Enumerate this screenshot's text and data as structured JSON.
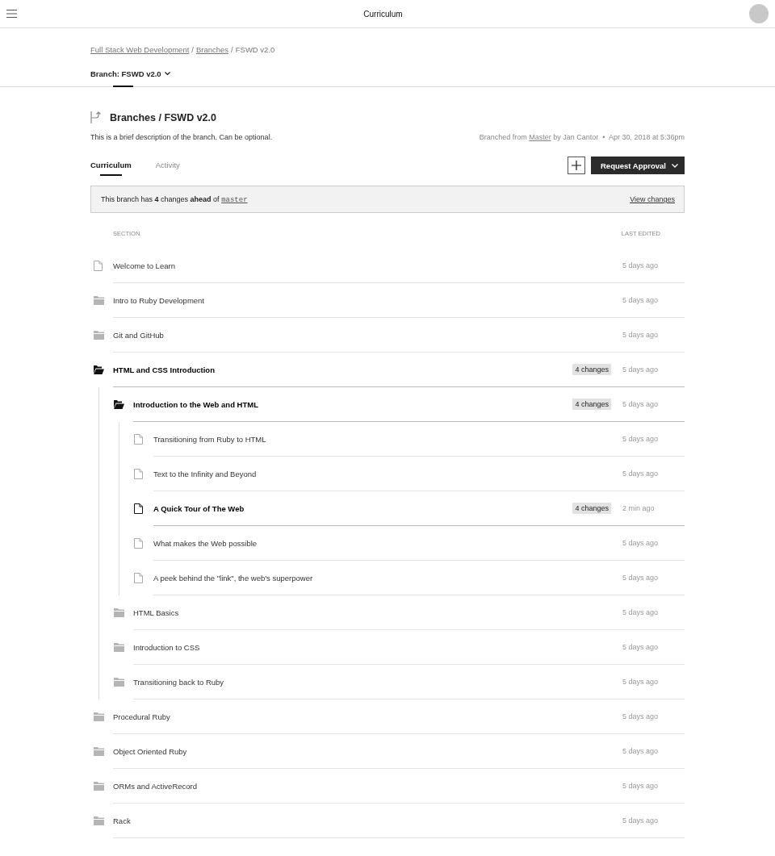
{
  "header": {
    "title": "Curriculum"
  },
  "breadcrumb": [
    {
      "label": "Full Stack Web Development",
      "link": true,
      "separator": "/"
    },
    {
      "label": "Branches",
      "link": true,
      "separator": "/"
    },
    {
      "label": "FSWD v2.0",
      "link": false
    }
  ],
  "branch_selector": {
    "label": "Branch: FSWD v2.0"
  },
  "branch": {
    "title": "Branches / FSWD v2.0",
    "description": "This is a brief description of the branch. Can be optional.",
    "meta": {
      "prefix": "Branched from",
      "source": "Master",
      "author": "by Jan Cantor",
      "separator": "•",
      "date": "Apr 30, 2018 at 5:36pm"
    }
  },
  "tabs": [
    {
      "label": "Curriculum",
      "selected": true
    },
    {
      "label": "Activity",
      "selected": false
    }
  ],
  "actions": {
    "primary": "Request Approval"
  },
  "banner": {
    "text": "This branch has **4** changes **ahead** of",
    "ref": "master",
    "link": "View changes"
  },
  "table": {
    "columns": [
      "SECTION",
      "LAST EDITED"
    ],
    "rows": [
      {
        "kind": "file",
        "title": "Welcome to Learn",
        "edited": "5 days ago",
        "modified": false
      },
      {
        "kind": "folder",
        "title": "Intro to Ruby Development",
        "edited": "5 days ago",
        "modified": false,
        "expanded": false
      },
      {
        "kind": "folder",
        "title": "Git and GitHub",
        "edited": "5 days ago",
        "modified": false,
        "expanded": false
      },
      {
        "kind": "folder",
        "title": "HTML and CSS Introduction",
        "edited": "5 days ago",
        "modified": true,
        "changes": "4 changes",
        "expanded": true,
        "children": [
          {
            "kind": "folder",
            "title": "Introduction to the Web and HTML",
            "edited": "5 days ago",
            "modified": true,
            "changes": "4 changes",
            "expanded": true,
            "children": [
              {
                "kind": "file",
                "title": "Transitioning from Ruby to HTML",
                "edited": "5 days ago",
                "modified": false
              },
              {
                "kind": "file",
                "title": "Text to the Infinity and Beyond",
                "edited": "5 days ago",
                "modified": false
              },
              {
                "kind": "file",
                "title": "A Quick Tour of The Web",
                "edited": "2 min ago",
                "modified": true,
                "changes": "4 changes"
              },
              {
                "kind": "file",
                "title": "What makes the Web possible",
                "edited": "5 days ago",
                "modified": false
              },
              {
                "kind": "file",
                "title": "A peek behind the \"link\", the web's superpower",
                "edited": "5 days ago",
                "modified": false
              }
            ]
          },
          {
            "kind": "folder",
            "title": "HTML Basics",
            "edited": "5 days ago",
            "modified": false,
            "expanded": false
          },
          {
            "kind": "folder",
            "title": "Introduction to CSS",
            "edited": "5 days ago",
            "modified": false,
            "expanded": false
          },
          {
            "kind": "folder",
            "title": "Transitioning back to Ruby",
            "edited": "5 days ago",
            "modified": false,
            "expanded": false
          }
        ]
      },
      {
        "kind": "folder",
        "title": "Procedural Ruby",
        "edited": "5 days ago",
        "modified": false,
        "expanded": false
      },
      {
        "kind": "folder",
        "title": "Object Oriented Ruby",
        "edited": "5 days ago",
        "modified": false,
        "expanded": false
      },
      {
        "kind": "folder",
        "title": "ORMs and ActiveRecord",
        "edited": "5 days ago",
        "modified": false,
        "expanded": false
      },
      {
        "kind": "folder",
        "title": "Rack",
        "edited": "5 days ago",
        "modified": false,
        "expanded": false
      }
    ]
  }
}
